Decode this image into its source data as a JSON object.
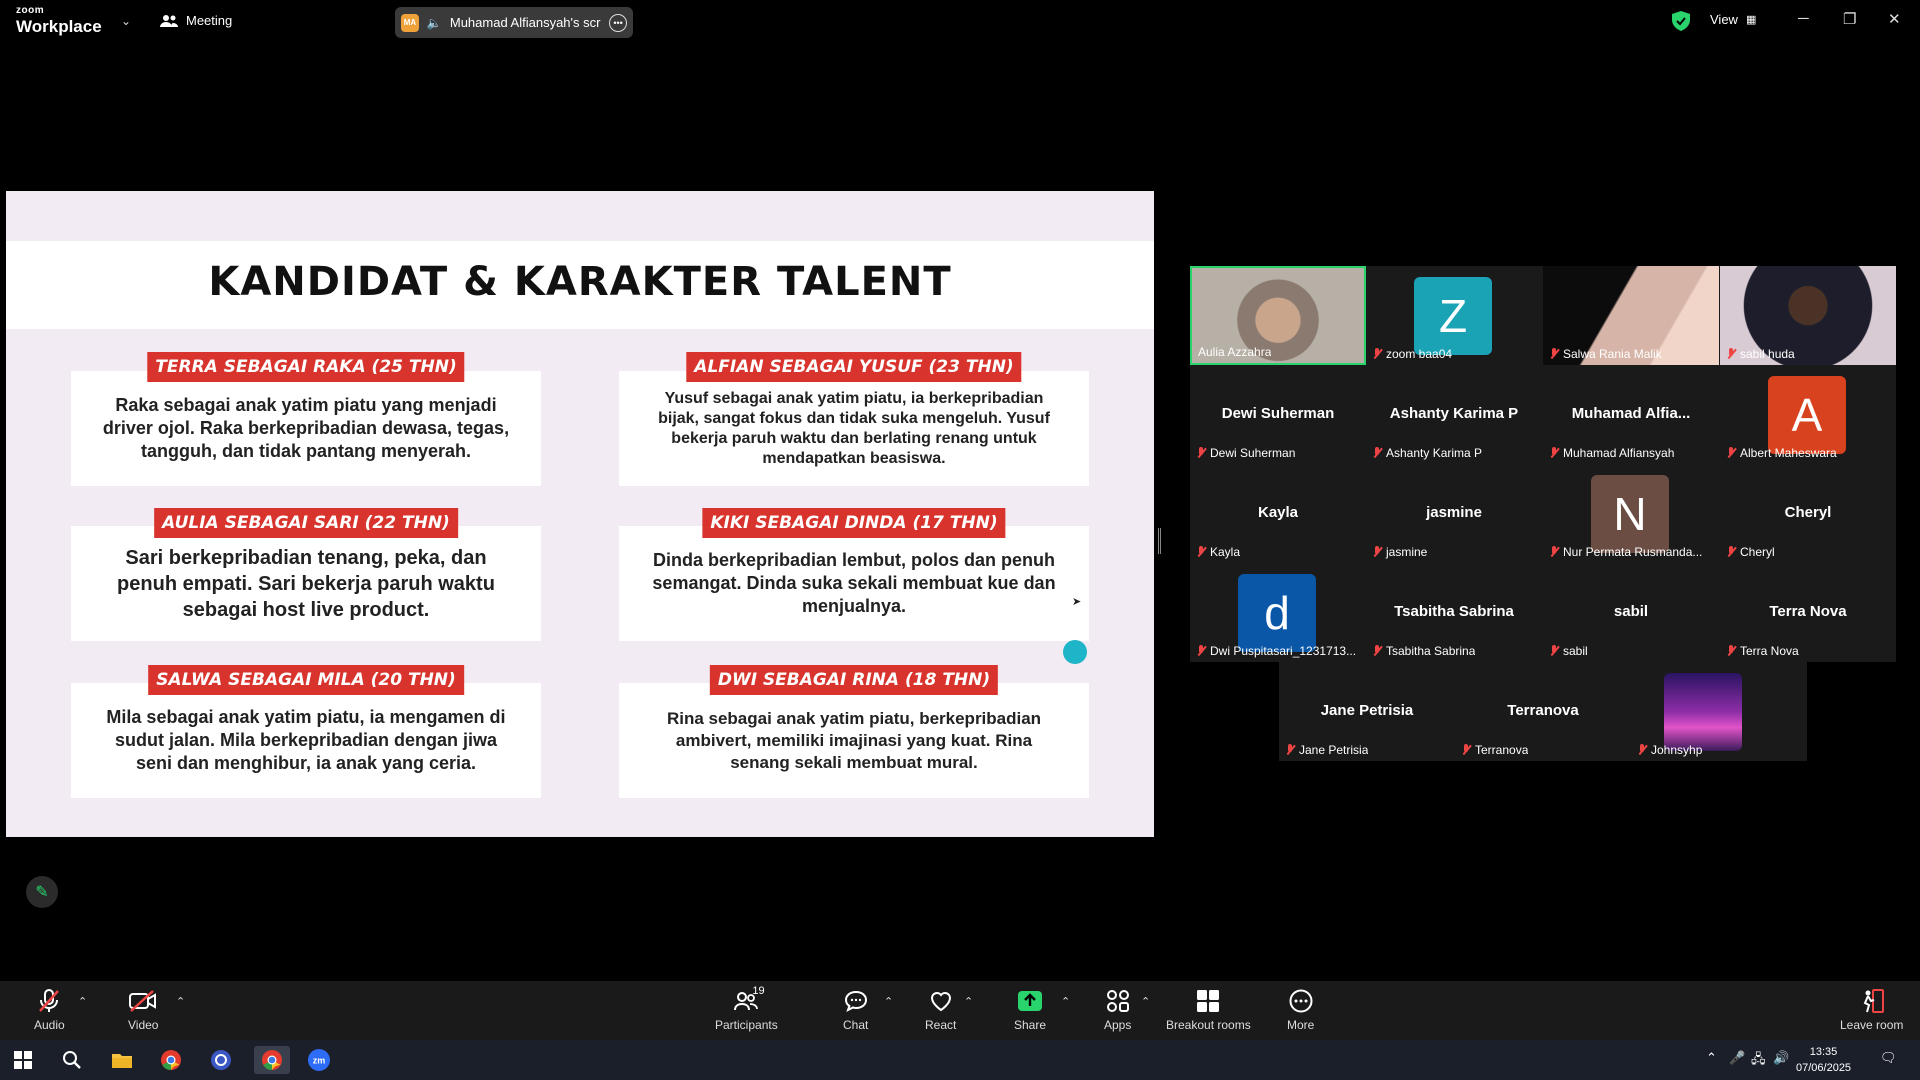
{
  "app": {
    "brand_small": "zoom",
    "brand_big": "Workplace"
  },
  "topbar": {
    "meeting_label": "Meeting",
    "share_initials": "MA",
    "share_label": "Muhamad Alfiansyah's scree",
    "view_label": "View"
  },
  "slide": {
    "title": "KANDIDAT & KARAKTER TALENT",
    "cards": [
      {
        "tag": "TERRA SEBAGAI RAKA (25 THN)",
        "text": "Raka sebagai anak yatim piatu yang menjadi driver ojol. Raka berkepribadian dewasa, tegas, tangguh, dan tidak pantang menyerah."
      },
      {
        "tag": "ALFIAN SEBAGAI YUSUF (23 THN)",
        "text": "Yusuf sebagai anak yatim piatu, ia berkepribadian bijak, sangat fokus dan tidak suka mengeluh. Yusuf bekerja paruh waktu dan berlating renang untuk mendapatkan beasiswa."
      },
      {
        "tag": "AULIA SEBAGAI SARI (22 THN)",
        "text": "Sari  berkepribadian tenang, peka, dan penuh empati. Sari bekerja paruh waktu sebagai host live product."
      },
      {
        "tag": "KIKI SEBAGAI DINDA (17 THN)",
        "text": "Dinda berkepribadian lembut, polos dan penuh semangat. Dinda suka sekali membuat kue dan menjualnya."
      },
      {
        "tag": "SALWA SEBAGAI MILA (20 THN)",
        "text": "Mila sebagai anak yatim piatu, ia mengamen di sudut jalan. Mila berkepribadian dengan jiwa seni dan menghibur, ia anak yang ceria."
      },
      {
        "tag": "DWI SEBAGAI RINA (18 THN)",
        "text": "Rina sebagai anak yatim piatu, berkepribadian ambivert, memiliki imajinasi yang kuat. Rina senang sekali membuat mural."
      }
    ]
  },
  "participants": [
    {
      "label": "Aulia Azzahra",
      "kind": "video"
    },
    {
      "label": "zoom baa04",
      "avatar": "Z",
      "avatar_color": "#1aa3b5"
    },
    {
      "label": "Salwa Rania Malik",
      "kind": "video"
    },
    {
      "label": "sabil huda",
      "kind": "video"
    },
    {
      "label": "Dewi Suherman",
      "center": "Dewi Suherman"
    },
    {
      "label": "Ashanty Karima P",
      "center": "Ashanty Karima P"
    },
    {
      "label": "Muhamad Alfiansyah",
      "center": "Muhamad  Alfia..."
    },
    {
      "label": "Albert Maheswara",
      "avatar": "A",
      "avatar_color": "#d9421f"
    },
    {
      "label": "Kayla",
      "center": "Kayla"
    },
    {
      "label": "jasmine",
      "center": "jasmine"
    },
    {
      "label": "Nur Permata Rusmanda...",
      "avatar": "N",
      "avatar_color": "#6b4d44"
    },
    {
      "label": "Cheryl",
      "center": "Cheryl"
    },
    {
      "label": "Dwi Puspitasari_1231713...",
      "avatar": "d",
      "avatar_color": "#0a57a8"
    },
    {
      "label": "Tsabitha Sabrina",
      "center": "Tsabitha Sabrina"
    },
    {
      "label": "sabil",
      "center": "sabil"
    },
    {
      "label": "Terra Nova",
      "center": "Terra Nova"
    },
    {
      "label": "Jane Petrisia",
      "center": "Jane Petrisia"
    },
    {
      "label": "Terranova",
      "center": "Terranova"
    },
    {
      "label": "Johnsyhp",
      "kind": "image"
    }
  ],
  "toolbar": {
    "audio": "Audio",
    "video": "Video",
    "participants": "Participants",
    "participants_count": "19",
    "chat": "Chat",
    "react": "React",
    "share": "Share",
    "apps": "Apps",
    "breakout": "Breakout rooms",
    "more": "More",
    "leave": "Leave room"
  },
  "taskbar": {
    "time": "13:35",
    "date": "07/06/2025"
  },
  "colors": {
    "accent_green": "#2ad46c",
    "tag_red": "#d8332c",
    "slide_bg": "#f3ebf3"
  }
}
